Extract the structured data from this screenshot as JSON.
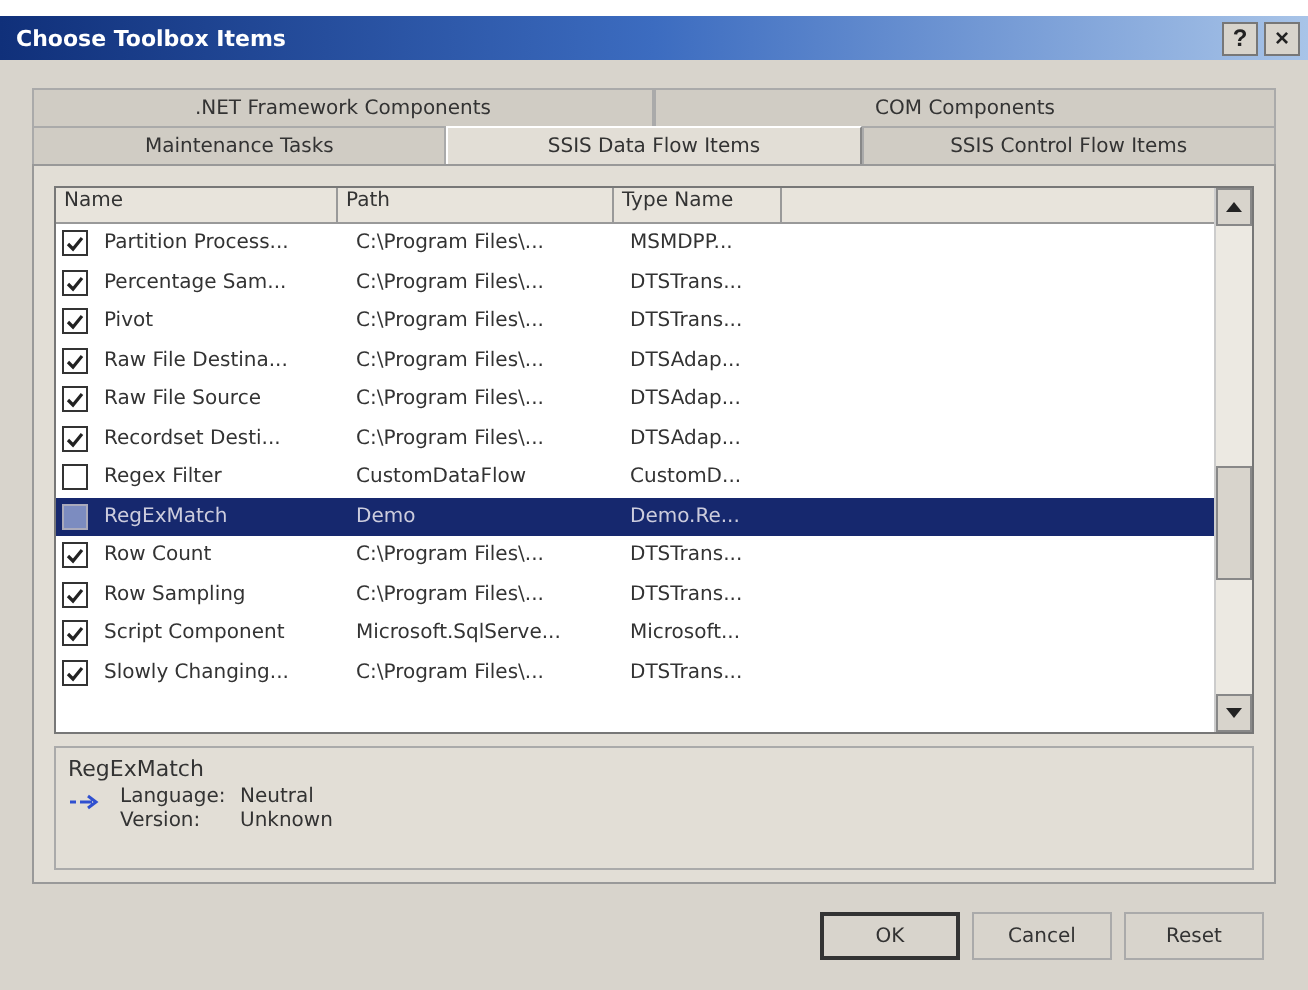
{
  "window": {
    "title": "Choose Toolbox Items",
    "help": "?",
    "close": "×"
  },
  "tab_rows": [
    [
      {
        "label": ".NET Framework Components",
        "selected": false
      },
      {
        "label": "COM Components",
        "selected": false
      }
    ],
    [
      {
        "label": "Maintenance Tasks",
        "selected": false
      },
      {
        "label": "SSIS Data Flow Items",
        "selected": true
      },
      {
        "label": "SSIS Control Flow Items",
        "selected": false
      }
    ]
  ],
  "table": {
    "columns": [
      "Name",
      "Path",
      "Type Name"
    ],
    "rows": [
      {
        "cells": [
          "Partition Process...",
          "C:\\Program Files\\...",
          "MSMDPP..."
        ],
        "checked": true,
        "selected": false
      },
      {
        "cells": [
          "Percentage Sam...",
          "C:\\Program Files\\...",
          "DTSTrans..."
        ],
        "checked": true,
        "selected": false
      },
      {
        "cells": [
          "Pivot",
          "C:\\Program Files\\...",
          "DTSTrans..."
        ],
        "checked": true,
        "selected": false
      },
      {
        "cells": [
          "Raw File Destina...",
          "C:\\Program Files\\...",
          "DTSAdap..."
        ],
        "checked": true,
        "selected": false
      },
      {
        "cells": [
          "Raw File Source",
          "C:\\Program Files\\...",
          "DTSAdap..."
        ],
        "checked": true,
        "selected": false
      },
      {
        "cells": [
          "Recordset Desti...",
          "C:\\Program Files\\...",
          "DTSAdap..."
        ],
        "checked": true,
        "selected": false
      },
      {
        "cells": [
          "Regex Filter",
          "CustomDataFlow",
          "CustomD..."
        ],
        "checked": false,
        "selected": false
      },
      {
        "cells": [
          "RegExMatch",
          "Demo",
          "Demo.Re..."
        ],
        "checked": false,
        "selected": true
      },
      {
        "cells": [
          "Row Count",
          "C:\\Program Files\\...",
          "DTSTrans..."
        ],
        "checked": true,
        "selected": false
      },
      {
        "cells": [
          "Row Sampling",
          "C:\\Program Files\\...",
          "DTSTrans..."
        ],
        "checked": true,
        "selected": false
      },
      {
        "cells": [
          "Script Component",
          "Microsoft.SqlServe...",
          "Microsoft..."
        ],
        "checked": true,
        "selected": false
      },
      {
        "cells": [
          "Slowly Changing...",
          "C:\\Program Files\\...",
          "DTSTrans..."
        ],
        "checked": true,
        "selected": false
      }
    ]
  },
  "details": {
    "name": "RegExMatch",
    "fields": [
      {
        "label": "Language:",
        "value": "Neutral"
      },
      {
        "label": "Version:",
        "value": "Unknown"
      }
    ]
  },
  "buttons": [
    {
      "label": "OK",
      "default": true
    },
    {
      "label": "Cancel",
      "default": false
    },
    {
      "label": "Reset",
      "default": false
    }
  ]
}
